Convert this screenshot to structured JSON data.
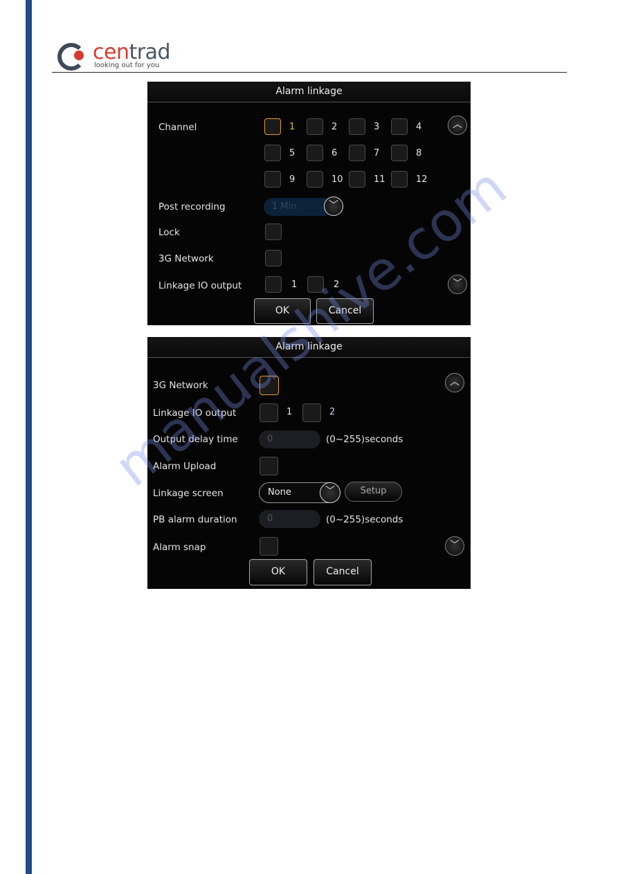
{
  "logo": {
    "word_a": "cen",
    "word_b": "trad",
    "tagline": "looking out for you",
    "colors": {
      "red": "#d63a2f",
      "grey": "#4a5563"
    }
  },
  "sidebar_color": "#1f4a87",
  "watermark": "manualshive.com",
  "screen1": {
    "title": "Alarm linkage",
    "channel_label": "Channel",
    "channels": [
      "1",
      "2",
      "3",
      "4",
      "5",
      "6",
      "7",
      "8",
      "9",
      "10",
      "11",
      "12"
    ],
    "selected_channel": "1",
    "post_recording_label": "Post recording",
    "post_recording_value": "1 Min",
    "lock_label": "Lock",
    "network_label": "3G Network",
    "io_label": "Linkage IO output",
    "io_outputs": [
      "1",
      "2"
    ],
    "ok": "OK",
    "cancel": "Cancel"
  },
  "screen2": {
    "title": "Alarm linkage",
    "network_label": "3G Network",
    "io_label": "Linkage IO output",
    "io_outputs": [
      "1",
      "2"
    ],
    "delay_label": "Output delay time",
    "delay_value": "0",
    "delay_unit": "(0~255)seconds",
    "upload_label": "Alarm Upload",
    "screen_label": "Linkage screen",
    "screen_value": "None",
    "setup": "Setup",
    "pb_label": "PB alarm duration",
    "pb_value": "0",
    "pb_unit": "(0~255)seconds",
    "snap_label": "Alarm snap",
    "ok": "OK",
    "cancel": "Cancel"
  }
}
